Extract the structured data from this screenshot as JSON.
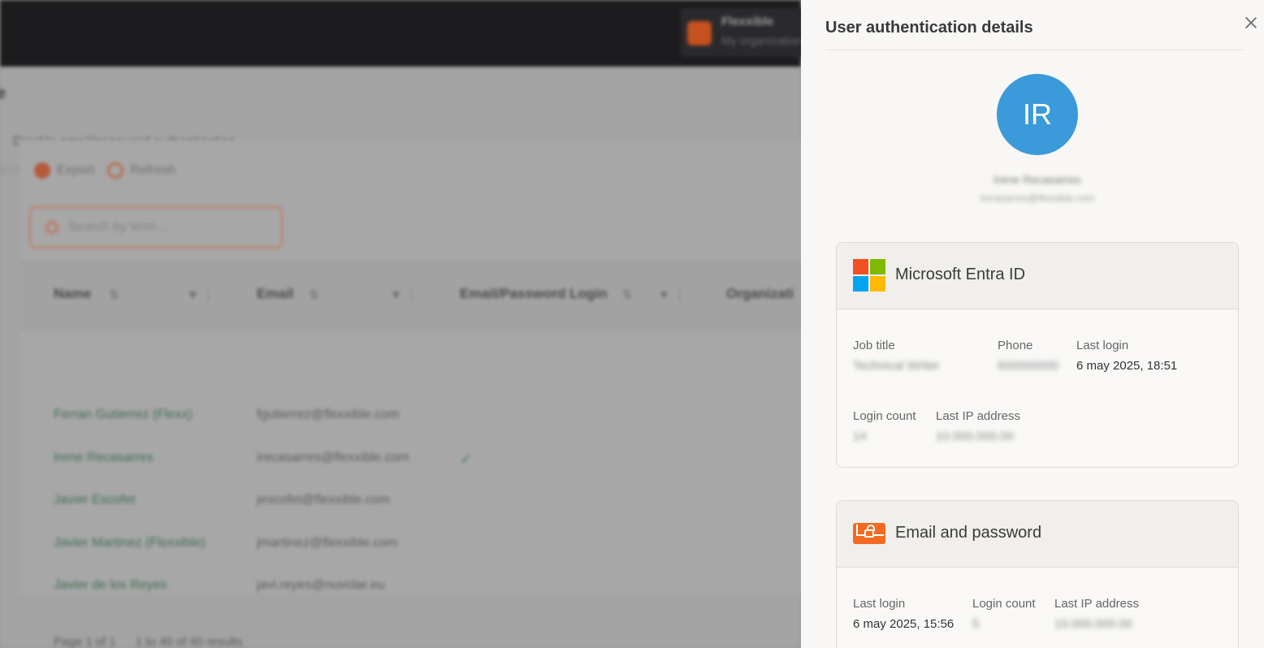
{
  "background": {
    "org": {
      "name": "Flexxible",
      "subtitle": "My organization"
    },
    "heading": "e",
    "disable_label": "Disable email/password authentication",
    "toolbar": {
      "export_label": "Export",
      "refresh_label": "Refresh"
    },
    "search": {
      "placeholder": "Search by term..."
    },
    "table": {
      "columns": [
        "Name",
        "Email",
        "Email/Password Login",
        "Organizati"
      ],
      "rows": [
        {
          "name": "Ferran Gutierrez (Flexx)",
          "email": "fgutierrez@flexxible.com",
          "email_password_login": ""
        },
        {
          "name": "Irene Recasarres",
          "email": "irecasarres@flexxible.com",
          "email_password_login": "✓"
        },
        {
          "name": "Javier Escofet",
          "email": "jescofet@flexxible.com",
          "email_password_login": ""
        },
        {
          "name": "Javier Martinez (Flexxible)",
          "email": "jmartinez@flexxible.com",
          "email_password_login": ""
        },
        {
          "name": "Javier de los Reyes",
          "email": "javi.reyes@nuvolar.eu",
          "email_password_login": ""
        }
      ]
    },
    "pager": {
      "page_text": "Page 1 of 1",
      "results_text": "1 to 40 of 40 results"
    }
  },
  "panel": {
    "title": "User authentication details",
    "user": {
      "initials": "IR",
      "name": "Irene Recasarres",
      "email": "irecasarres@flexxible.com"
    },
    "providers": {
      "microsoft": {
        "title": "Microsoft Entra ID",
        "logo_colors": [
          "#f25022",
          "#7fba00",
          "#00a4ef",
          "#ffb900"
        ],
        "fields": {
          "job_title": {
            "label": "Job title",
            "value": "Technical Writer"
          },
          "phone": {
            "label": "Phone",
            "value": "600000000"
          },
          "last_login": {
            "label": "Last login",
            "value": "6 may 2025, 18:51"
          },
          "login_count": {
            "label": "Login count",
            "value": "14"
          },
          "last_ip": {
            "label": "Last IP address",
            "value": "10.000.000.00"
          }
        }
      },
      "email_password": {
        "title": "Email and password",
        "icon_color": "#f36a22",
        "fields": {
          "last_login": {
            "label": "Last login",
            "value": "6 may 2025, 15:56"
          },
          "login_count": {
            "label": "Login count",
            "value": "5"
          },
          "last_ip": {
            "label": "Last IP address",
            "value": "10.000.000.00"
          }
        }
      }
    }
  },
  "colors": {
    "avatar": "#3b9ad9",
    "accent": "#f36a22"
  }
}
